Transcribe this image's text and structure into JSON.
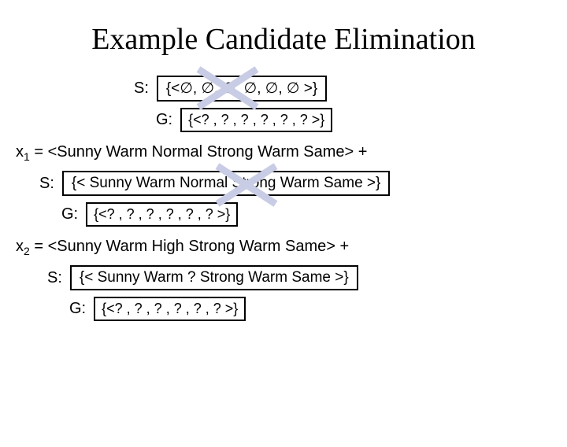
{
  "title": "Example Candidate Elimination",
  "initial": {
    "s_label": "S:",
    "s_value": "{<∅, ∅, ∅, ∅, ∅, ∅ >}",
    "g_label": "G:",
    "g_value": "{<? , ? , ? , ? , ? , ? >}"
  },
  "x1": {
    "text": "x₁ = <Sunny Warm Normal Strong Warm Same> +",
    "s_label": "S:",
    "s_value": "{< Sunny Warm Normal Strong Warm Same >}",
    "g_label": "G:",
    "g_value": "{<? , ? , ? , ? , ? , ? >}"
  },
  "x2": {
    "text": "x₂ = <Sunny Warm High Strong Warm Same> +",
    "s_label": "S:",
    "s_value": "{< Sunny Warm ? Strong Warm Same >}",
    "g_label": "G:",
    "g_value": "{<? , ? , ? , ? , ? , ? >}"
  }
}
